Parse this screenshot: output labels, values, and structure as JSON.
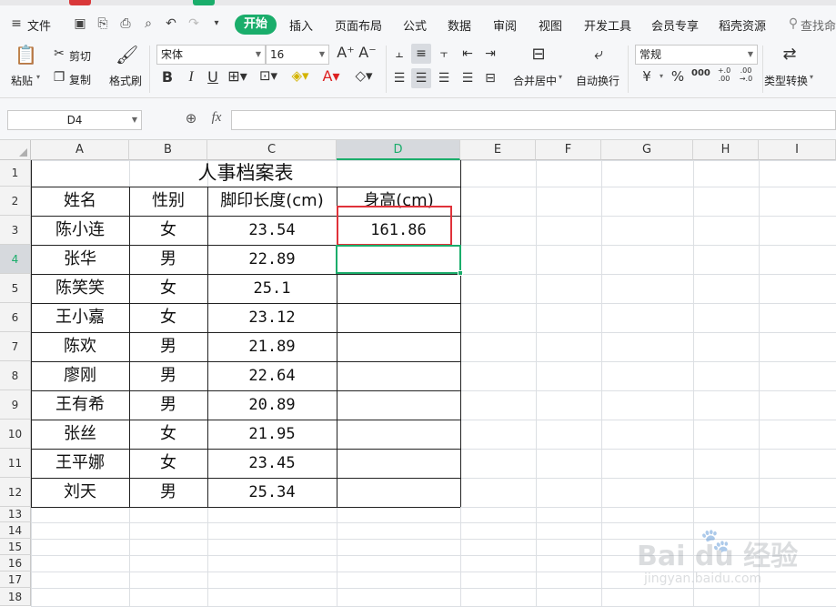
{
  "menu": {
    "file": "文件",
    "tabs": [
      "开始",
      "插入",
      "页面布局",
      "公式",
      "数据",
      "审阅",
      "视图",
      "开发工具",
      "会员专享",
      "稻壳资源"
    ],
    "search": "查找命"
  },
  "ribbon": {
    "paste": "粘贴",
    "cut": "剪切",
    "copy": "复制",
    "format_painter": "格式刷",
    "font_name": "宋体",
    "font_size": "16",
    "merge_center": "合并居中",
    "wrap_text": "自动换行",
    "number_format": "常规",
    "type_convert": "类型转换",
    "bold": "B",
    "italic": "I",
    "underline": "U",
    "currency": "¥",
    "percent": "%",
    "thousands": "000",
    "inc_decimal": "+.0 .00",
    "dec_decimal": ".00 →.0"
  },
  "formula_bar": {
    "cell_ref": "D4",
    "fx": "fx",
    "value": ""
  },
  "grid": {
    "columns": [
      "A",
      "B",
      "C",
      "D",
      "E",
      "F",
      "G",
      "H",
      "I"
    ],
    "rows": [
      "1",
      "2",
      "3",
      "4",
      "5",
      "6",
      "7",
      "8",
      "9",
      "10",
      "11",
      "12",
      "13",
      "14",
      "15",
      "16",
      "17",
      "18"
    ],
    "active_col": "D",
    "active_row": "4"
  },
  "sheet": {
    "title": "人事档案表",
    "headers": [
      "姓名",
      "性别",
      "脚印长度(cm)",
      "身高(cm)"
    ],
    "records": [
      {
        "name": "陈小连",
        "gender": "女",
        "foot": "23.54",
        "height": "161.86"
      },
      {
        "name": "张华",
        "gender": "男",
        "foot": "22.89",
        "height": ""
      },
      {
        "name": "陈笑笑",
        "gender": "女",
        "foot": "25.1",
        "height": ""
      },
      {
        "name": "王小嘉",
        "gender": "女",
        "foot": "23.12",
        "height": ""
      },
      {
        "name": "陈欢",
        "gender": "男",
        "foot": "21.89",
        "height": ""
      },
      {
        "name": "廖刚",
        "gender": "男",
        "foot": "22.64",
        "height": ""
      },
      {
        "name": "王有希",
        "gender": "男",
        "foot": "20.89",
        "height": ""
      },
      {
        "name": "张丝",
        "gender": "女",
        "foot": "21.95",
        "height": ""
      },
      {
        "name": "王平娜",
        "gender": "女",
        "foot": "23.45",
        "height": ""
      },
      {
        "name": "刘天",
        "gender": "男",
        "foot": "25.34",
        "height": ""
      }
    ]
  },
  "watermark": {
    "brand": "Bai du 经验",
    "url": "jingyan.baidu.com"
  },
  "colors": {
    "accent": "#1aad6b",
    "highlight": "#e0323a"
  }
}
